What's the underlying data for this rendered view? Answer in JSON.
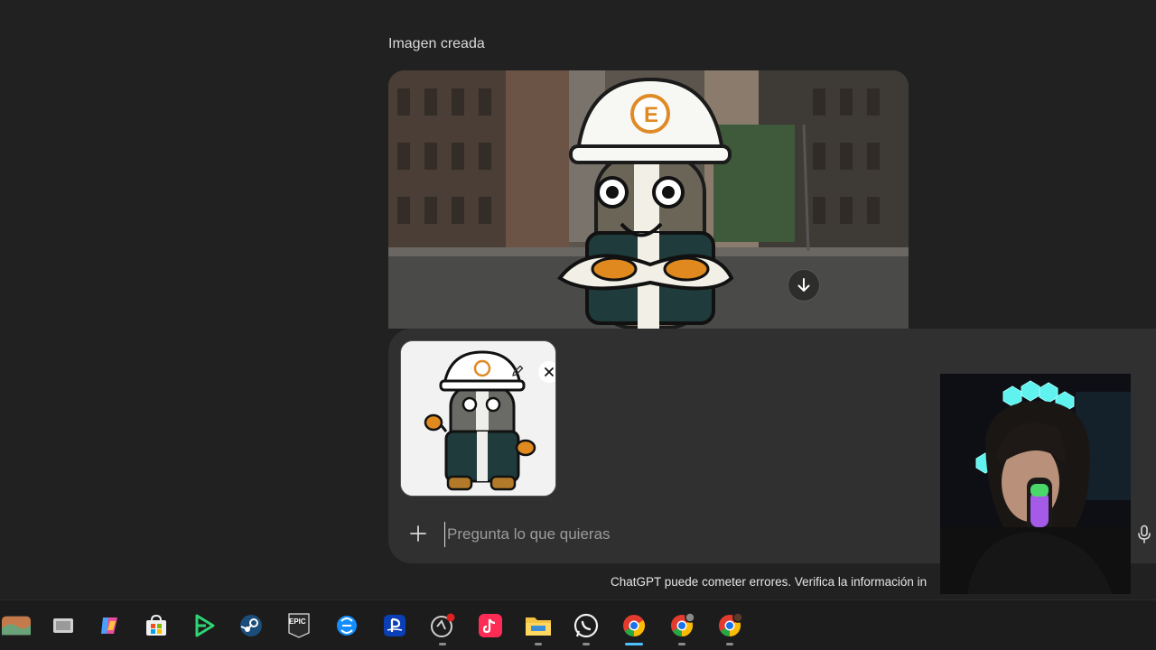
{
  "chat": {
    "created_label": "Imagen creada"
  },
  "composer": {
    "placeholder": "Pregunta lo que quieras"
  },
  "footer": {
    "disclaimer": "ChatGPT puede cometer errores. Verifica la información in"
  },
  "icons": {
    "download": "arrow-down-icon",
    "edit": "pencil-icon",
    "close": "close-icon",
    "plus": "plus-icon",
    "mic": "microphone-icon"
  },
  "taskbar": {
    "items": [
      {
        "name": "widgets"
      },
      {
        "name": "task-view"
      },
      {
        "name": "copilot"
      },
      {
        "name": "microsoft-store"
      },
      {
        "name": "game-launcher"
      },
      {
        "name": "steam"
      },
      {
        "name": "epic-games",
        "label": "EPIC"
      },
      {
        "name": "battle-net"
      },
      {
        "name": "playstation"
      },
      {
        "name": "recorder"
      },
      {
        "name": "tiktok"
      },
      {
        "name": "file-explorer"
      },
      {
        "name": "whatsapp"
      },
      {
        "name": "chrome-1"
      },
      {
        "name": "chrome-2"
      },
      {
        "name": "chrome-3"
      }
    ]
  },
  "colors": {
    "background": "#212121",
    "composer": "#303030",
    "taskbar": "#1c1c1c",
    "active_indicator": "#4cc2ff"
  }
}
